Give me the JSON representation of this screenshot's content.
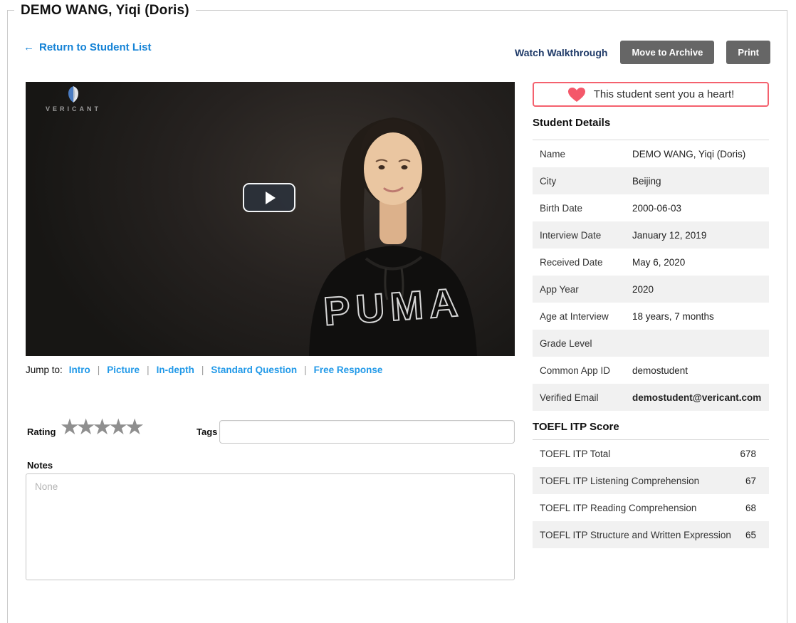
{
  "page": {
    "title": "DEMO WANG, Yiqi (Doris)"
  },
  "header": {
    "return_arrow": "←",
    "return_link": "Return to Student List",
    "watch_walkthrough": "Watch Walkthrough",
    "archive_button": "Move to Archive",
    "print_button": "Print"
  },
  "video": {
    "brand": "VERICANT",
    "shirt_text": "PUMA"
  },
  "jump": {
    "label": "Jump to:",
    "separator": "|",
    "links": [
      "Intro",
      "Picture",
      "In-depth",
      "Standard Question",
      "Free Response"
    ]
  },
  "banner": {
    "text": "This student sent you a heart!"
  },
  "details": {
    "heading": "Student Details",
    "rows": [
      {
        "label": "Name",
        "value": "DEMO WANG, Yiqi (Doris)"
      },
      {
        "label": "City",
        "value": "Beijing"
      },
      {
        "label": "Birth Date",
        "value": "2000-06-03"
      },
      {
        "label": "Interview Date",
        "value": "January 12, 2019"
      },
      {
        "label": "Received Date",
        "value": "May 6, 2020"
      },
      {
        "label": "App Year",
        "value": "2020"
      },
      {
        "label": "Age at Interview",
        "value": "18 years, 7 months"
      },
      {
        "label": "Grade Level",
        "value": ""
      },
      {
        "label": "Common App ID",
        "value": "demostudent"
      },
      {
        "label": "Verified Email",
        "value": "demostudent@vericant.com"
      }
    ]
  },
  "toefl": {
    "heading": "TOEFL ITP Score",
    "rows": [
      {
        "label": "TOEFL ITP Total",
        "value": "678"
      },
      {
        "label": "TOEFL ITP Listening Comprehension",
        "value": "67"
      },
      {
        "label": "TOEFL ITP Reading Comprehension",
        "value": "68"
      },
      {
        "label": "TOEFL ITP Structure and Written Expression",
        "value": "65"
      }
    ]
  },
  "rating": {
    "label": "Rating",
    "star_glyph": "★",
    "count": 5
  },
  "tags": {
    "label": "Tags",
    "value": ""
  },
  "notes": {
    "label": "Notes",
    "placeholder": "None"
  },
  "colors": {
    "link_blue": "#2199e8",
    "return_blue": "#1583d6",
    "navy": "#1f3a68",
    "button_gray": "#666666",
    "heart_red": "#f4586a",
    "banner_border": "#f4616e",
    "stripe_gray": "#f1f1f1"
  }
}
